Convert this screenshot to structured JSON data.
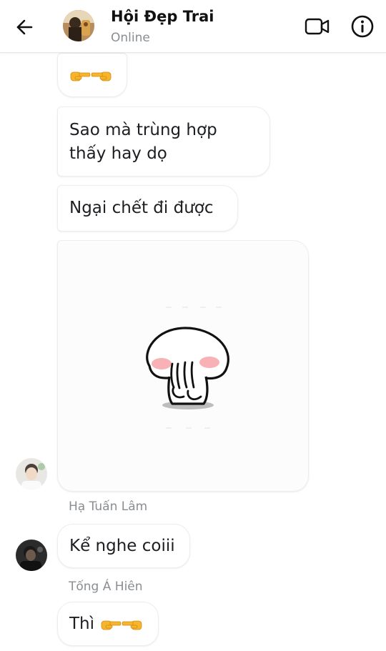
{
  "header": {
    "title": "Hội Đẹp Trai",
    "status": "Online",
    "avatar_icon": "group-avatar",
    "back_icon": "arrow-left-icon",
    "video_icon": "video-camera-icon",
    "info_icon": "info-circle-icon"
  },
  "messages": [
    {
      "type": "emoji",
      "emoji_icon": "backhand-index-pointing-hands-icon"
    },
    {
      "type": "text",
      "lines": [
        "Sao mà trùng hợp",
        "thấy hay dọ"
      ]
    },
    {
      "type": "text",
      "text": "Ngại chết đi được"
    },
    {
      "type": "sticker",
      "sticker_icon": "blushing-bunny-sticker"
    },
    {
      "type": "sender",
      "name": "Hạ Tuấn Lâm"
    },
    {
      "type": "text",
      "text": "Kể nghe coiii"
    },
    {
      "type": "sender",
      "name": "Tống Á Hiên"
    },
    {
      "type": "text",
      "text": "Thì",
      "emoji_icon": "backhand-index-pointing-hands-icon"
    }
  ],
  "colors": {
    "status_gray": "#8a8d91",
    "bubble_bg": "#ffffff",
    "emoji_yellow": "#f7b52c"
  }
}
